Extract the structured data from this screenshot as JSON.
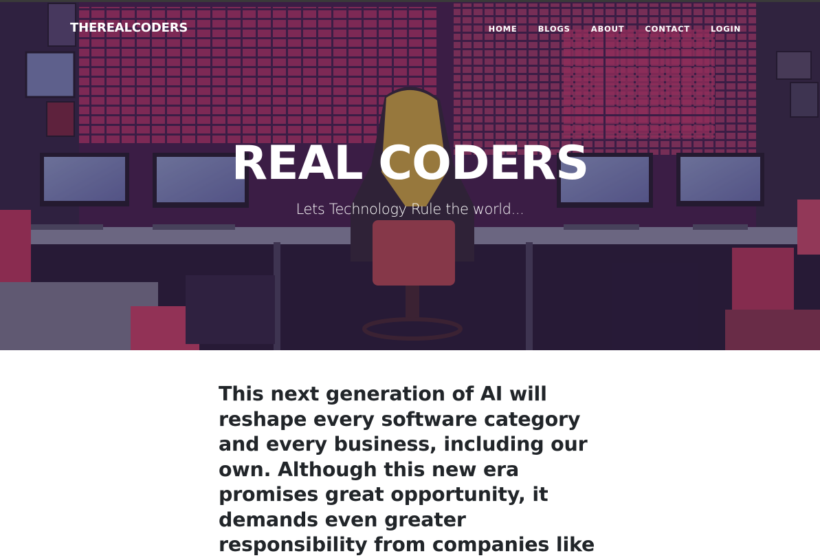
{
  "header": {
    "brand": "THEREALCODERS",
    "nav": [
      {
        "label": "HOME"
      },
      {
        "label": "BLOGS"
      },
      {
        "label": "ABOUT"
      },
      {
        "label": "CONTACT"
      },
      {
        "label": "LOGIN"
      }
    ]
  },
  "hero": {
    "title": "REAL CODERS",
    "subtitle": "Lets Technology Rule the world..."
  },
  "article": {
    "heading": "This next generation of AI will reshape every software category and every business, including our own. Although this new era promises great opportunity, it demands even greater responsibility from companies like"
  },
  "colors": {
    "hero_dark": "#2b1a3c",
    "hero_magenta": "#d0407a",
    "text_white": "#ffffff",
    "text_dark": "#212529"
  }
}
